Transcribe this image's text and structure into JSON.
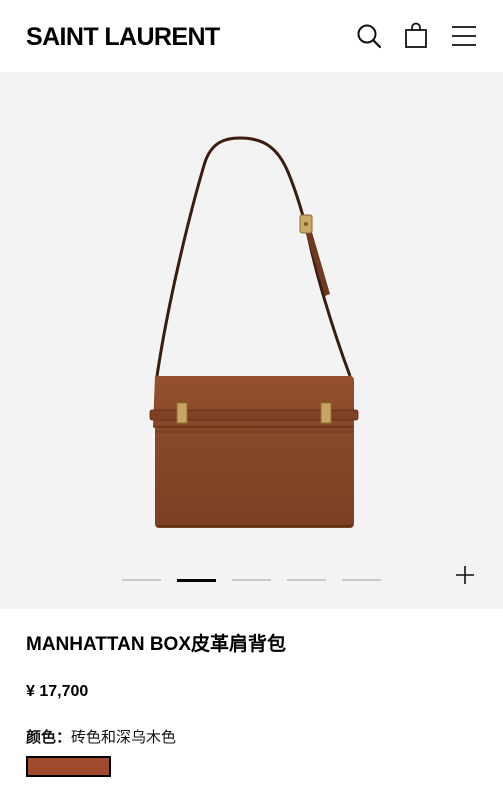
{
  "header": {
    "brand": "SAINT LAURENT",
    "icons": [
      "search-icon",
      "shopping-bag-icon",
      "menu-icon"
    ]
  },
  "gallery": {
    "image_count": 5,
    "active_index": 1,
    "zoom_icon": "plus-icon"
  },
  "product": {
    "name": "MANHATTAN BOX皮革肩背包",
    "price": "¥ 17,700",
    "color_label": "颜色：",
    "color_value": "砖色和深乌木色",
    "swatch_color": "#a0492c"
  },
  "colors": {
    "bag_leather": "#8b4a2b",
    "gallery_bg": "#f3f3f3"
  }
}
